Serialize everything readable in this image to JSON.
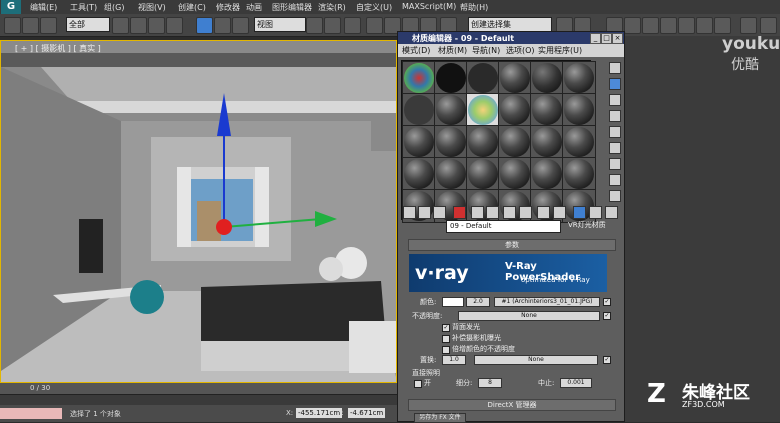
{
  "menubar": {
    "logo": "G",
    "items": [
      "编辑(E)",
      "工具(T)",
      "组(G)",
      "视图(V)",
      "创建(C)",
      "修改器",
      "动画",
      "图形编辑器",
      "渲染(R)",
      "自定义(U)",
      "MAXScript(M)",
      "帮助(H)"
    ]
  },
  "toolbar": {
    "selection_filter": "全部",
    "view_dropdown": "视图",
    "named_selection": "创建选择集"
  },
  "viewport": {
    "label": "[ + ] [ 摄影机 ] [ 真实 ]"
  },
  "timeline": {
    "frame": "0 / 30"
  },
  "status": {
    "message": "选择了 1 个对象",
    "x_label": "X:",
    "x_value": "-455.171cm",
    "y_label": "Y:",
    "y_value": "-4.671cm"
  },
  "material_editor": {
    "title": "材质编辑器 - 09 - Default",
    "window_buttons": [
      "_",
      "□",
      "×"
    ],
    "menus": [
      "模式(D)",
      "材质(M)",
      "导航(N)",
      "选项(O)",
      "实用程序(U)"
    ],
    "material_name": "09 - Default",
    "material_type": "VR灯光材质",
    "rollout_params": "参数",
    "banner": {
      "logo": "v·ray",
      "title": "V-Ray PowerShader",
      "subtitle": "optimized for V-Ray"
    },
    "color_label": "颜色:",
    "color_value": "2.0",
    "color_map": "#1 (Archinteriors3_01_01.JPG)",
    "opacity_label": "不透明度:",
    "opacity_map": "None",
    "checkbox_1": "背面发光",
    "checkbox_2": "补偿摄影机曝光",
    "checkbox_3": "倍增颜色的不透明度",
    "displace_label": "置换:",
    "displace_value": "1.0",
    "displace_map": "None",
    "direct_label": "直接照明",
    "direct_on": "开",
    "subdiv_label": "细分:",
    "subdiv_value": "8",
    "cutoff_label": "中止:",
    "cutoff_value": "0.001",
    "directx_label": "DirectX 管理器",
    "save_label": "另存为 FX 文件"
  },
  "watermarks": {
    "youku": "youku",
    "youku_cn": "优酷",
    "site_logo": "Z",
    "site_name": "朱峰社区",
    "site_url": "ZF3D.COM"
  },
  "colors": {
    "viewport_border": "#e2b600",
    "gizmo_z": "#1a3ad0",
    "gizmo_x": "#e02020",
    "gizmo_y": "#20b040",
    "banner": "#1b5fa3"
  }
}
